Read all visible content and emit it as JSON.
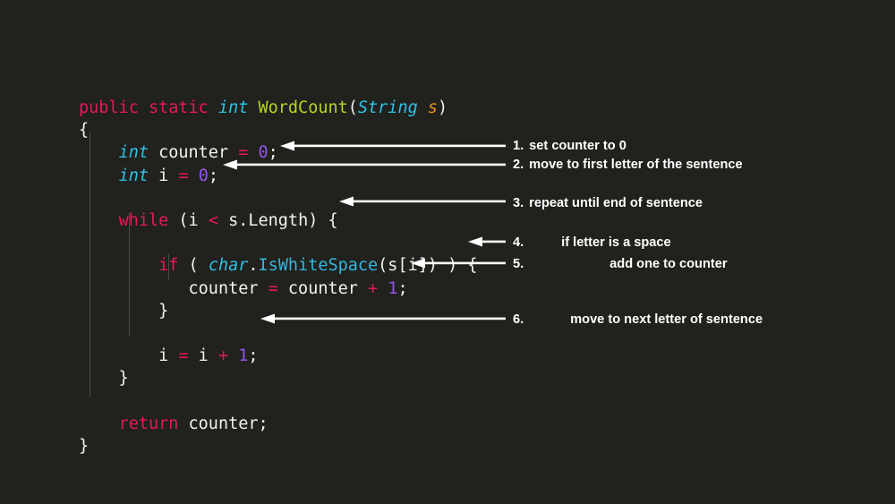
{
  "slide": {
    "background_color": "#21211d",
    "kind": "code-explanation-slide"
  },
  "palette": {
    "background": "#21211d",
    "plain_text": "#f2f2ef",
    "keyword": "#e8175d",
    "type": "#2fc2e8",
    "function_name": "#b8d321",
    "method_name": "#35b6e0",
    "parameter": "#e8911a",
    "number": "#9357e8",
    "operator": "#e8175d",
    "arrow": "#ffffff",
    "annotation_text": "#ffffff",
    "indent_guide": "#4a4a44"
  },
  "code": {
    "language": "C#",
    "lines": [
      {
        "id": "line-signature",
        "text": "public static int WordCount(String s)",
        "tokens": [
          {
            "t": "public",
            "c": "kw"
          },
          {
            "t": " ",
            "c": "pl"
          },
          {
            "t": "static",
            "c": "kw"
          },
          {
            "t": " ",
            "c": "pl"
          },
          {
            "t": "int",
            "c": "type"
          },
          {
            "t": " ",
            "c": "pl"
          },
          {
            "t": "WordCount",
            "c": "fn"
          },
          {
            "t": "(",
            "c": "pl"
          },
          {
            "t": "String",
            "c": "type"
          },
          {
            "t": " ",
            "c": "pl"
          },
          {
            "t": "s",
            "c": "param"
          },
          {
            "t": ")",
            "c": "pl"
          }
        ]
      },
      {
        "id": "line-open-brace",
        "text": "{",
        "tokens": [
          {
            "t": "{",
            "c": "pl"
          }
        ]
      },
      {
        "id": "line-counter-decl",
        "text": "    int counter = 0;",
        "tokens": [
          {
            "t": "    ",
            "c": "pl"
          },
          {
            "t": "int",
            "c": "type"
          },
          {
            "t": " counter ",
            "c": "pl"
          },
          {
            "t": "=",
            "c": "op"
          },
          {
            "t": " ",
            "c": "pl"
          },
          {
            "t": "0",
            "c": "num"
          },
          {
            "t": ";",
            "c": "pl"
          }
        ]
      },
      {
        "id": "line-i-decl",
        "text": "    int i = 0;",
        "tokens": [
          {
            "t": "    ",
            "c": "pl"
          },
          {
            "t": "int",
            "c": "type"
          },
          {
            "t": " i ",
            "c": "pl"
          },
          {
            "t": "=",
            "c": "op"
          },
          {
            "t": " ",
            "c": "pl"
          },
          {
            "t": "0",
            "c": "num"
          },
          {
            "t": ";",
            "c": "pl"
          }
        ]
      },
      {
        "id": "line-blank-1",
        "text": " ",
        "tokens": [
          {
            "t": " ",
            "c": "pl"
          }
        ]
      },
      {
        "id": "line-while",
        "text": "    while (i < s.Length) {",
        "tokens": [
          {
            "t": "    ",
            "c": "pl"
          },
          {
            "t": "while",
            "c": "kw"
          },
          {
            "t": " (i ",
            "c": "pl"
          },
          {
            "t": "<",
            "c": "op"
          },
          {
            "t": " s.Length) {",
            "c": "pl"
          }
        ]
      },
      {
        "id": "line-blank-2",
        "text": " ",
        "tokens": [
          {
            "t": " ",
            "c": "pl"
          }
        ]
      },
      {
        "id": "line-if",
        "text": "        if ( char.IsWhiteSpace(s[i]) ) {",
        "tokens": [
          {
            "t": "        ",
            "c": "pl"
          },
          {
            "t": "if",
            "c": "kw"
          },
          {
            "t": " ( ",
            "c": "pl"
          },
          {
            "t": "char",
            "c": "type"
          },
          {
            "t": ".",
            "c": "pl"
          },
          {
            "t": "IsWhiteSpace",
            "c": "meth"
          },
          {
            "t": "(s[i]) ) {",
            "c": "pl"
          }
        ]
      },
      {
        "id": "line-increment-counter",
        "text": "           counter = counter + 1;",
        "tokens": [
          {
            "t": "           ",
            "c": "pl"
          },
          {
            "t": "counter ",
            "c": "pl"
          },
          {
            "t": "=",
            "c": "op"
          },
          {
            "t": " counter ",
            "c": "pl"
          },
          {
            "t": "+",
            "c": "op"
          },
          {
            "t": " ",
            "c": "pl"
          },
          {
            "t": "1",
            "c": "num"
          },
          {
            "t": ";",
            "c": "pl"
          }
        ]
      },
      {
        "id": "line-close-if",
        "text": "        }",
        "tokens": [
          {
            "t": "        }",
            "c": "pl"
          }
        ]
      },
      {
        "id": "line-blank-3",
        "text": " ",
        "tokens": [
          {
            "t": " ",
            "c": "pl"
          }
        ]
      },
      {
        "id": "line-increment-i",
        "text": "        i = i + 1;",
        "tokens": [
          {
            "t": "        i ",
            "c": "pl"
          },
          {
            "t": "=",
            "c": "op"
          },
          {
            "t": " i ",
            "c": "pl"
          },
          {
            "t": "+",
            "c": "op"
          },
          {
            "t": " ",
            "c": "pl"
          },
          {
            "t": "1",
            "c": "num"
          },
          {
            "t": ";",
            "c": "pl"
          }
        ]
      },
      {
        "id": "line-close-while",
        "text": "    }",
        "tokens": [
          {
            "t": "    }",
            "c": "pl"
          }
        ]
      },
      {
        "id": "line-blank-4",
        "text": " ",
        "tokens": [
          {
            "t": " ",
            "c": "pl"
          }
        ]
      },
      {
        "id": "line-return",
        "text": "    return counter;",
        "tokens": [
          {
            "t": "    ",
            "c": "pl"
          },
          {
            "t": "return",
            "c": "kw"
          },
          {
            "t": " counter;",
            "c": "pl"
          }
        ]
      },
      {
        "id": "line-close-method",
        "text": "}",
        "tokens": [
          {
            "t": "}",
            "c": "pl"
          }
        ]
      }
    ]
  },
  "annotations": [
    {
      "id": "anno-1",
      "number": "1.",
      "indent": "sm",
      "text": "set counter to 0"
    },
    {
      "id": "anno-2",
      "number": "2.",
      "indent": "sm",
      "text": "move to first letter of the sentence"
    },
    {
      "id": "anno-3",
      "number": "3.",
      "indent": "sm",
      "text": "repeat until end of sentence"
    },
    {
      "id": "anno-4",
      "number": "4.",
      "indent": "md",
      "text": "if letter is a space"
    },
    {
      "id": "anno-5",
      "number": "5.",
      "indent": "lg",
      "text": "add one to counter"
    },
    {
      "id": "anno-6",
      "number": "6.",
      "indent": "xl",
      "text": "move to next letter of sentence"
    }
  ],
  "arrows": [
    {
      "id": "arrow-1",
      "points_to": "line-counter-decl",
      "direction": "left"
    },
    {
      "id": "arrow-2",
      "points_to": "line-i-decl",
      "direction": "left"
    },
    {
      "id": "arrow-3",
      "points_to": "line-while",
      "direction": "left"
    },
    {
      "id": "arrow-4",
      "points_to": "line-if",
      "direction": "left"
    },
    {
      "id": "arrow-5",
      "points_to": "line-increment-counter",
      "direction": "left"
    },
    {
      "id": "arrow-6",
      "points_to": "line-increment-i",
      "direction": "left"
    }
  ]
}
